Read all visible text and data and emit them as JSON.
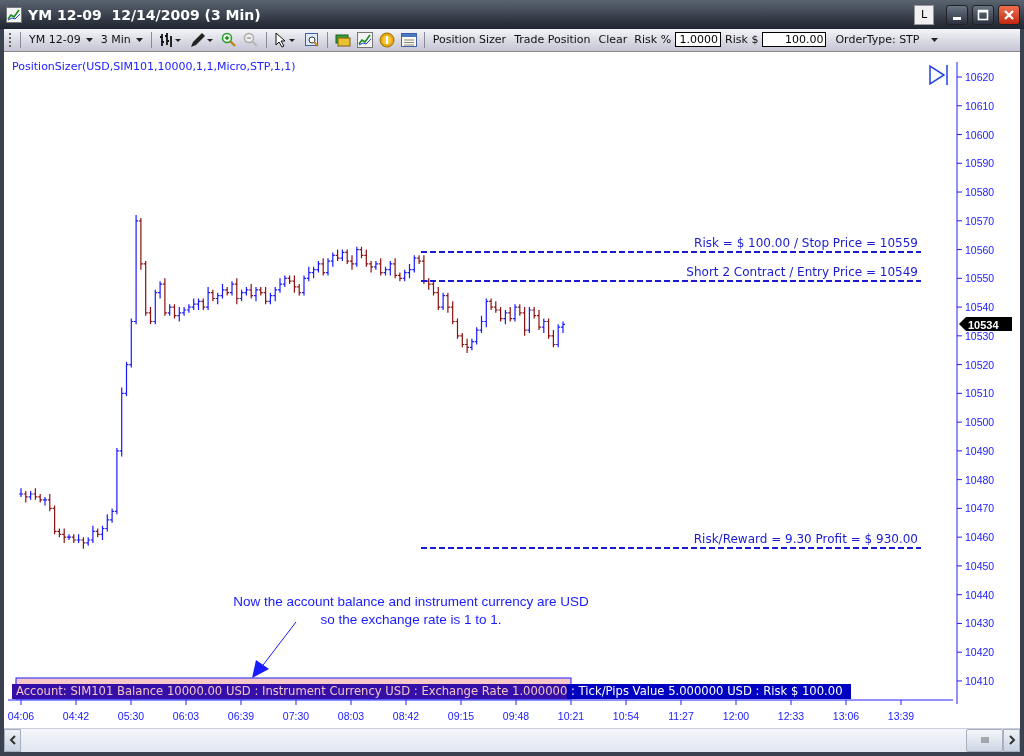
{
  "window": {
    "title": "YM 12-09  12/14/2009 (3 Min)",
    "buttons": [
      "L"
    ]
  },
  "toolbar": {
    "instrument": "YM 12-09",
    "interval": "3 Min",
    "buttons": [
      "Position Sizer",
      "Trade Position",
      "Clear"
    ],
    "risk_percent": {
      "label": "Risk %",
      "value": "1.0000"
    },
    "risk_dollar": {
      "label": "Risk $",
      "value": "100.00"
    },
    "order_type": "OrderType: STP"
  },
  "chart": {
    "indicator_label": "PositionSizer(USD,SIM101,10000,1,1,Micro,STP,1,1)",
    "price_axis": [
      "10620",
      "10610",
      "10600",
      "10590",
      "10580",
      "10570",
      "10560",
      "10550",
      "10540",
      "10530",
      "10520",
      "10510",
      "10500",
      "10490",
      "10480",
      "10470",
      "10460",
      "10450",
      "10440",
      "10430",
      "10420",
      "10410"
    ],
    "last_price": "10534",
    "time_axis": [
      "04:06",
      "04:42",
      "05:30",
      "06:03",
      "06:39",
      "07:30",
      "08:03",
      "08:42",
      "09:15",
      "09:48",
      "10:21",
      "10:54",
      "11:27",
      "12:00",
      "12:33",
      "13:06",
      "13:39"
    ],
    "levels": [
      {
        "label": "Risk = $ 100.00 / Stop Price = 10559"
      },
      {
        "label": "Short 2 Contract / Entry Price = 10549"
      },
      {
        "label": "Risk/Reward = 9.30 Profit = $ 930.00"
      }
    ],
    "annotation": [
      "Now the account balance and instrument currency are USD",
      "so the exchange rate is 1 to 1."
    ],
    "status": {
      "account": "Account: SIM101 Balance 10000.00 USD : Instrument Currency USD : Exchange Rate 1.000000",
      "risk": " : Tick/Pips Value 5.000000 USD : Risk $ 100.00"
    }
  }
}
